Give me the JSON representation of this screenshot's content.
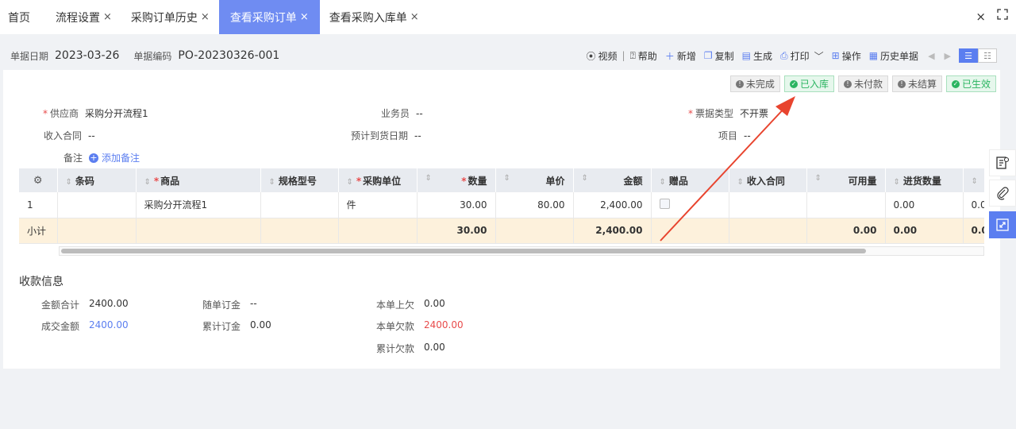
{
  "tabs": [
    {
      "label": "首页",
      "closable": false,
      "active": false
    },
    {
      "label": "流程设置",
      "closable": true,
      "active": false
    },
    {
      "label": "采购订单历史",
      "closable": true,
      "active": false
    },
    {
      "label": "查看采购订单",
      "closable": true,
      "active": true
    },
    {
      "label": "查看采购入库单",
      "closable": true,
      "active": false
    }
  ],
  "tab_close_symbol": "×",
  "header": {
    "date_label": "单据日期",
    "date_value": "2023-03-26",
    "code_label": "单据编码",
    "code_value": "PO-20230326-001"
  },
  "toolbar": {
    "video": "视频",
    "separator": "|",
    "help": "帮助",
    "add": "新增",
    "copy": "复制",
    "generate": "生成",
    "print": "打印",
    "operate": "操作",
    "history": "历史单据"
  },
  "statuses": [
    {
      "label": "未完成",
      "style": "gray"
    },
    {
      "label": "已入库",
      "style": "green"
    },
    {
      "label": "未付款",
      "style": "gray"
    },
    {
      "label": "未结算",
      "style": "gray"
    },
    {
      "label": "已生效",
      "style": "green"
    }
  ],
  "form": {
    "supplier_label": "供应商",
    "supplier_value": "采购分开流程1",
    "salesman_label": "业务员",
    "salesman_value": "--",
    "invoice_type_label": "票据类型",
    "invoice_type_value": "不开票",
    "income_contract_label": "收入合同",
    "income_contract_value": "--",
    "expected_date_label": "预计到货日期",
    "expected_date_value": "--",
    "project_label": "项目",
    "project_value": "--",
    "remark_label": "备注",
    "add_remark": "添加备注",
    "required_mark": "*"
  },
  "table": {
    "headers": [
      "条码",
      "商品",
      "规格型号",
      "采购单位",
      "数量",
      "单价",
      "金额",
      "赠品",
      "收入合同",
      "可用量",
      "进货数量"
    ],
    "rows": [
      {
        "idx": "1",
        "barcode": "",
        "product": "采购分开流程1",
        "spec": "",
        "unit": "件",
        "qty": "30.00",
        "price": "80.00",
        "amount": "2,400.00",
        "gift": false,
        "contract": "",
        "available": "",
        "inbound": "0.00",
        "overflow": "0.0"
      }
    ],
    "subtotal": {
      "label": "小计",
      "qty": "30.00",
      "amount": "2,400.00",
      "available": "0.00",
      "inbound": "0.00",
      "overflow": "0.0"
    }
  },
  "payment": {
    "title": "收款信息",
    "total_label": "金额合计",
    "total_value": "2400.00",
    "deal_label": "成交金额",
    "deal_value": "2400.00",
    "order_deposit_label": "随单订金",
    "order_deposit_value": "--",
    "acc_deposit_label": "累计订金",
    "acc_deposit_value": "0.00",
    "prev_owed_label": "本单上欠",
    "prev_owed_value": "0.00",
    "owed_label": "本单欠款",
    "owed_value": "2400.00",
    "acc_owed_label": "累计欠款",
    "acc_owed_value": "0.00"
  },
  "colors": {
    "accent": "#5b7ef0",
    "tab_active": "#6f8cf2",
    "success": "#2bb561",
    "danger": "#e84b4b",
    "subtotal_bg": "#fdf1dc",
    "annotation_arrow": "#e8442e"
  }
}
